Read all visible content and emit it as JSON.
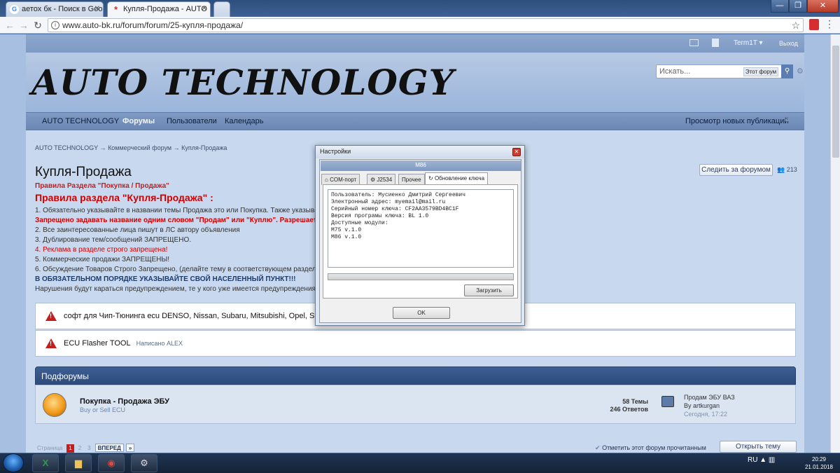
{
  "browser": {
    "tabs": [
      {
        "title": "аетох бк - Поиск в Goo",
        "icon": "G"
      },
      {
        "title": "Купля-Продажа - AUTO",
        "icon": "*"
      }
    ],
    "url": "www.auto-bk.ru/forum/forum/25-купля-продажа/"
  },
  "userbar": {
    "username": "Term1T",
    "logout": "Выход"
  },
  "header": {
    "logo": "AUTO TECHNOLOGY",
    "search_placeholder": "Искать...",
    "search_scope": "Этот форум"
  },
  "nav": {
    "items": [
      "AUTO TECHNOLOGY",
      "Форумы",
      "Пользователи",
      "Календарь"
    ],
    "active_index": 1,
    "new_posts": "Просмотр новых публикаций"
  },
  "breadcrumb": [
    "AUTO TECHNOLOGY",
    "Коммерческий форум",
    "Купля-Продажа"
  ],
  "page": {
    "title": "Купля-Продажа",
    "subtitle": "Правила Раздела \"Покупка / Продажа\"",
    "follow_button": "Следить за форумом",
    "follow_count": "213"
  },
  "rules": {
    "heading": "Правила раздела \"Купля-Продажа\" :",
    "line1": "1. Обязательно указывайте в названии темы Продажа это или Покупка. Также указыва",
    "line2": "Запрещено задавать название одним словом \"Продам\" или \"Куплю\". Разрешается",
    "line3": "2. Все заинтересованные лица пишут в ЛС автору объявления",
    "line4": "3. Дублирование тем/сообщений ЗАПРЕЩЕНО.",
    "line5": "4. Реклама в разделе строго запрещена!",
    "line6": "5. Коммерческие продажи ЗАПРЕЩЕНЫ!",
    "line7": "6. Обсуждение Товаров Строго Запрещено, (делайте тему в соответствующем разделе",
    "line8": "В ОБЯЗАТЕЛЬНОМ ПОРЯДКЕ УКАЗЫВАЙТЕ СВОЙ НАСЕЛЕННЫЙ ПУНКТ!!!",
    "line9": "Нарушения будут караться предупреждением, те у кого уже имеется предупреждения п"
  },
  "threads": [
    {
      "title": "софт для Чип-Тюнинга ecu DENSO, Nissan, Subaru, Mitsubishi, Opel, Suzu",
      "meta": ""
    },
    {
      "title": "ECU Flasher TOOL",
      "meta": "Написано ALEX"
    }
  ],
  "subforums": {
    "heading": "Подфорумы",
    "rows": [
      {
        "title": "Покупка - Продажа ЭБУ",
        "desc": "Buy or Sell ECU",
        "topics": "58 Темы",
        "replies": "246 Ответов",
        "last_post_title": "Продам ЭБУ ВАЗ",
        "last_post_by": "By artkurgan",
        "last_post_time": "Сегодня, 17:22"
      }
    ]
  },
  "pagination": {
    "label": "Страница",
    "pages": [
      "1",
      "2",
      "3"
    ],
    "next": "ВПЕРЕД",
    "last": "»"
  },
  "footer": {
    "mark_read": "Отметить этот форум прочитанным",
    "new_thread": "Открыть тему"
  },
  "dialog": {
    "title": "Настройки",
    "device": "M86",
    "tabs": [
      "COM-порт",
      "J2534",
      "Прочее",
      "Обновление ключа"
    ],
    "active_tab": 3,
    "info_lines": [
      "Пользователь: Мусиенко Дмитрий Сергеевич",
      "Электронный адрес: myemail@mail.ru",
      "Серийный номер ключа: CF2AA3579BD4BC1F",
      "Версия програмы ключа: BL 1.0",
      "Доступные модули:",
      "M75 v.1.0",
      "M86 v.1.0"
    ],
    "load_button": "Загрузить",
    "ok_button": "OK"
  },
  "taskbar": {
    "lang": "RU",
    "time": "20:29",
    "date": "21.01.2018"
  }
}
